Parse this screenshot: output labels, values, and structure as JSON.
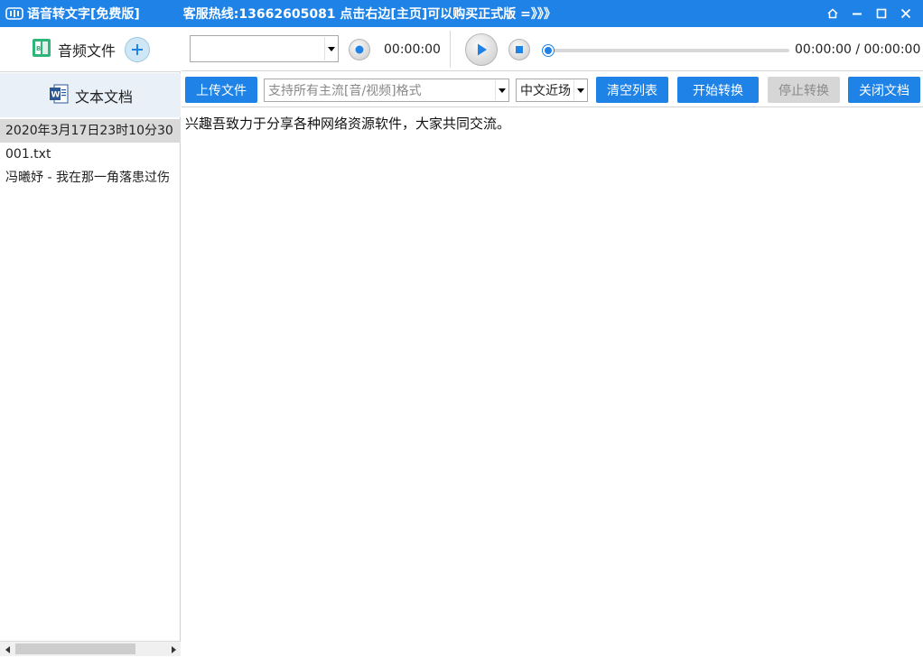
{
  "window": {
    "title": "语音转文字[免费版]",
    "hotline": "客服热线:13662605081  点击右边[主页]可以购买正式版 =》》》",
    "accent": "#1e82e6"
  },
  "sidebar": {
    "audio_tab_label": "音频文件",
    "doc_tab_label": "文本文档",
    "documents": [
      {
        "name": "2020年3月17日23时10分30"
      },
      {
        "name": "001.txt"
      },
      {
        "name": "冯曦妤 - 我在那一角落患过伤"
      }
    ]
  },
  "player": {
    "file_select_value": "",
    "record_time": "00:00:00",
    "position_text": "00:00:00 / 00:00:00",
    "progress": 0
  },
  "toolbar": {
    "upload_label": "上传文件",
    "format_placeholder": "支持所有主流[音/视频]格式",
    "language_value": "中文近场",
    "clear_label": "清空列表",
    "start_label": "开始转换",
    "stop_label": "停止转换",
    "close_label": "关闭文档"
  },
  "content": {
    "text": "兴趣吾致力于分享各种网络资源软件，大家共同交流。"
  }
}
